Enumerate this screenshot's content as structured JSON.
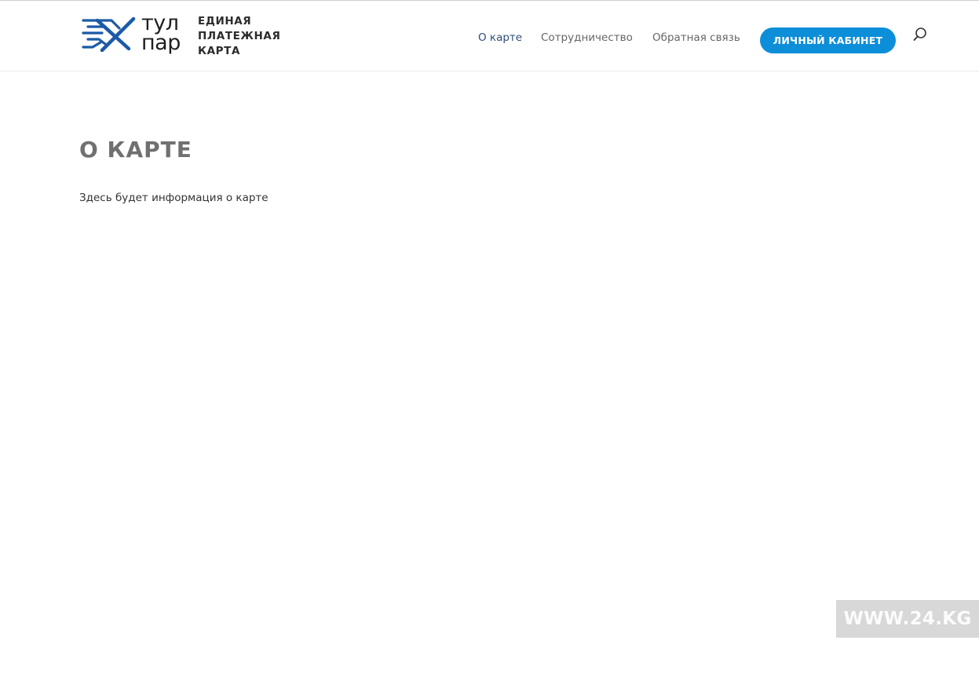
{
  "brand": {
    "wordmark_line1": "тул",
    "wordmark_line2": "пар",
    "tagline_line1": "ЕДИНАЯ",
    "tagline_line2": "ПЛАТЕЖНАЯ",
    "tagline_line3": "КАРТА",
    "mark_icon": "tulpar-logo-icon",
    "mark_color": "#1c5aa6"
  },
  "nav": {
    "items": [
      {
        "label": "О карте",
        "active": true
      },
      {
        "label": "Сотрудничество",
        "active": false
      },
      {
        "label": "Обратная связь",
        "active": false
      }
    ],
    "active_color": "#2d4f7a",
    "inactive_color": "#666666"
  },
  "header_button": {
    "label": "ЛИЧНЫЙ КАБИНЕТ",
    "color": "#0d8ed9"
  },
  "search": {
    "icon": "search-icon"
  },
  "main": {
    "title": "О КАРТЕ",
    "body": "Здесь будет информация о карте"
  },
  "watermark": {
    "text": "WWW.24.KG"
  }
}
